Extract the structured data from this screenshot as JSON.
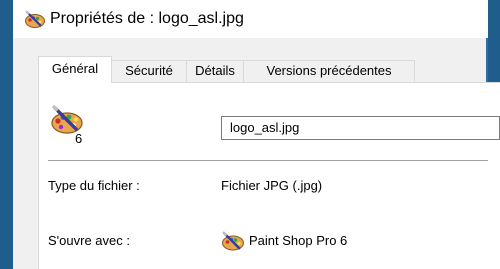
{
  "window": {
    "title": "Propriétés de : logo_asl.jpg",
    "icon": "paint-palette-icon"
  },
  "tabs": [
    {
      "label": "Général",
      "selected": true
    },
    {
      "label": "Sécurité",
      "selected": false
    },
    {
      "label": "Détails",
      "selected": false
    },
    {
      "label": "Versions précédentes",
      "selected": false
    }
  ],
  "general": {
    "file_icon": "paint-palette-icon",
    "file_icon_badge": "6",
    "file_name": "logo_asl.jpg",
    "type_label": "Type du fichier :",
    "type_value": "Fichier JPG (.jpg)",
    "opens_with_label": "S'ouvre avec :",
    "opens_with_value": "Paint Shop Pro 6",
    "opens_with_icon": "paint-palette-icon"
  },
  "colors": {
    "window_border": "#1e5d8c",
    "dialog_background": "#f0f0f0",
    "panel_background": "#ffffff"
  }
}
